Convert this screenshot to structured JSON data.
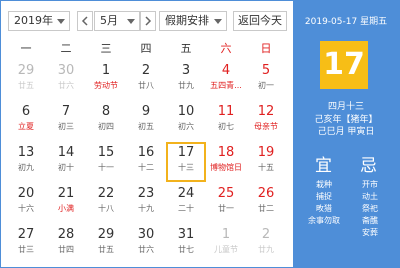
{
  "toolbar": {
    "year": "2019年",
    "month": "5月",
    "holiday": "假期安排",
    "back_today": "返回今天"
  },
  "weekdays": [
    "一",
    "二",
    "三",
    "四",
    "五",
    "六",
    "日"
  ],
  "weeks": [
    [
      {
        "n": "29",
        "s": "廿五",
        "t": "other"
      },
      {
        "n": "30",
        "s": "廿六",
        "t": "other"
      },
      {
        "n": "1",
        "s": "劳动节",
        "t": "holiday"
      },
      {
        "n": "2",
        "s": "廿八",
        "t": ""
      },
      {
        "n": "3",
        "s": "廿九",
        "t": ""
      },
      {
        "n": "4",
        "s": "五四青...",
        "t": "weekend holiday"
      },
      {
        "n": "5",
        "s": "初一",
        "t": "weekend"
      }
    ],
    [
      {
        "n": "6",
        "s": "立夏",
        "t": "holiday"
      },
      {
        "n": "7",
        "s": "初三",
        "t": ""
      },
      {
        "n": "8",
        "s": "初四",
        "t": ""
      },
      {
        "n": "9",
        "s": "初五",
        "t": ""
      },
      {
        "n": "10",
        "s": "初六",
        "t": ""
      },
      {
        "n": "11",
        "s": "初七",
        "t": "weekend"
      },
      {
        "n": "12",
        "s": "母亲节",
        "t": "weekend holiday"
      }
    ],
    [
      {
        "n": "13",
        "s": "初九",
        "t": ""
      },
      {
        "n": "14",
        "s": "初十",
        "t": ""
      },
      {
        "n": "15",
        "s": "十一",
        "t": ""
      },
      {
        "n": "16",
        "s": "十二",
        "t": ""
      },
      {
        "n": "17",
        "s": "十三",
        "t": "today"
      },
      {
        "n": "18",
        "s": "博物馆日",
        "t": "weekend holiday"
      },
      {
        "n": "19",
        "s": "十五",
        "t": "weekend"
      }
    ],
    [
      {
        "n": "20",
        "s": "十六",
        "t": ""
      },
      {
        "n": "21",
        "s": "小满",
        "t": "holiday"
      },
      {
        "n": "22",
        "s": "十八",
        "t": ""
      },
      {
        "n": "23",
        "s": "十九",
        "t": ""
      },
      {
        "n": "24",
        "s": "二十",
        "t": ""
      },
      {
        "n": "25",
        "s": "廿一",
        "t": "weekend"
      },
      {
        "n": "26",
        "s": "廿二",
        "t": "weekend"
      }
    ],
    [
      {
        "n": "27",
        "s": "廿三",
        "t": ""
      },
      {
        "n": "28",
        "s": "廿四",
        "t": ""
      },
      {
        "n": "29",
        "s": "廿五",
        "t": ""
      },
      {
        "n": "30",
        "s": "廿六",
        "t": ""
      },
      {
        "n": "31",
        "s": "廿七",
        "t": ""
      },
      {
        "n": "1",
        "s": "儿童节",
        "t": "other"
      },
      {
        "n": "2",
        "s": "廿九",
        "t": "other"
      }
    ]
  ],
  "panel": {
    "date": "2019-05-17 星期五",
    "day": "17",
    "lunar": "四月十三",
    "ganzhi_year": "己亥年【猪年】",
    "ganzhi_day": "己巳月 甲寅日",
    "yi": "宜",
    "ji": "忌",
    "yi_items": [
      "栽种",
      "捕捉",
      "畋猎",
      "余事勿取"
    ],
    "ji_items": [
      "开市",
      "动土",
      "祭祀",
      "斋醮",
      "安葬"
    ]
  }
}
